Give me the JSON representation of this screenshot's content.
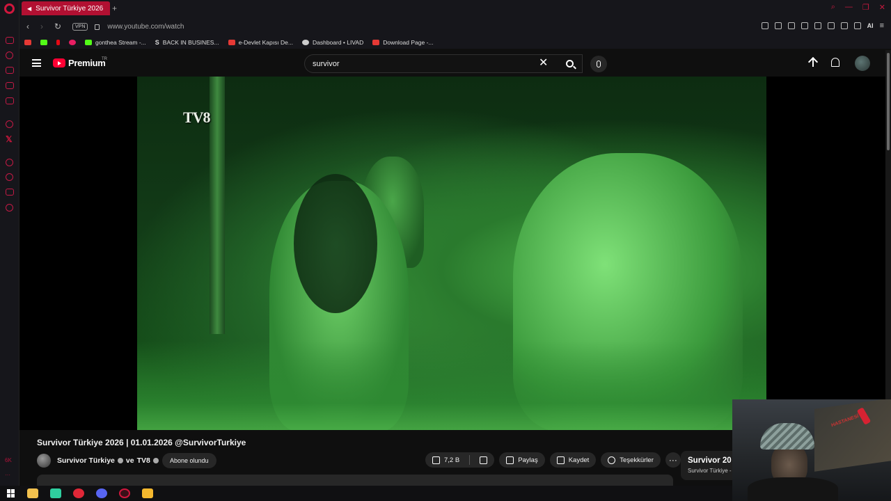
{
  "browser": {
    "tab": {
      "title": "Survivor Türkiye 2026"
    },
    "address": {
      "vpn_label": "VPN",
      "url": "www.youtube.com/watch"
    },
    "ai_label": "AI",
    "bookmarks": [
      {
        "label": "",
        "color": "#e53935"
      },
      {
        "label": "",
        "color": "#53fc18"
      },
      {
        "label": "",
        "color": "#e50914"
      },
      {
        "label": "",
        "color": "#e91e63"
      },
      {
        "label": "gonthea Stream -...",
        "color": "#53fc18"
      },
      {
        "label": "BACK IN BUSINES...",
        "color": "#ffffff",
        "glyph": "S"
      },
      {
        "label": "e-Devlet Kapısı De...",
        "color": "#e53935"
      },
      {
        "label": "Dashboard • LIVAD",
        "color": "#cccccc"
      },
      {
        "label": "Download Page -...",
        "color": "#e53935"
      }
    ],
    "sidebar_bottom": "6K",
    "accent": "#d0173d"
  },
  "yt": {
    "logo_text": "Premium",
    "region": "TR",
    "search_value": "survivor"
  },
  "video": {
    "watermark": "TV8",
    "title": "Survivor Türkiye 2026 | 01.01.2026 @SurvivorTurkiye",
    "channel": "Survivor Türkiye",
    "collab_sep": "ve",
    "collab": "TV8",
    "subscribe_label": "Abone olundu",
    "likes": "7,2 B",
    "share_label": "Paylaş",
    "save_label": "Kaydet",
    "thanks_label": "Teşekkürler",
    "more_label": "···"
  },
  "up_next": {
    "title": "Survivor 20",
    "channel": "Survivor Türkiye -"
  },
  "webcam": {
    "poster_text": "HASTANESİ"
  }
}
